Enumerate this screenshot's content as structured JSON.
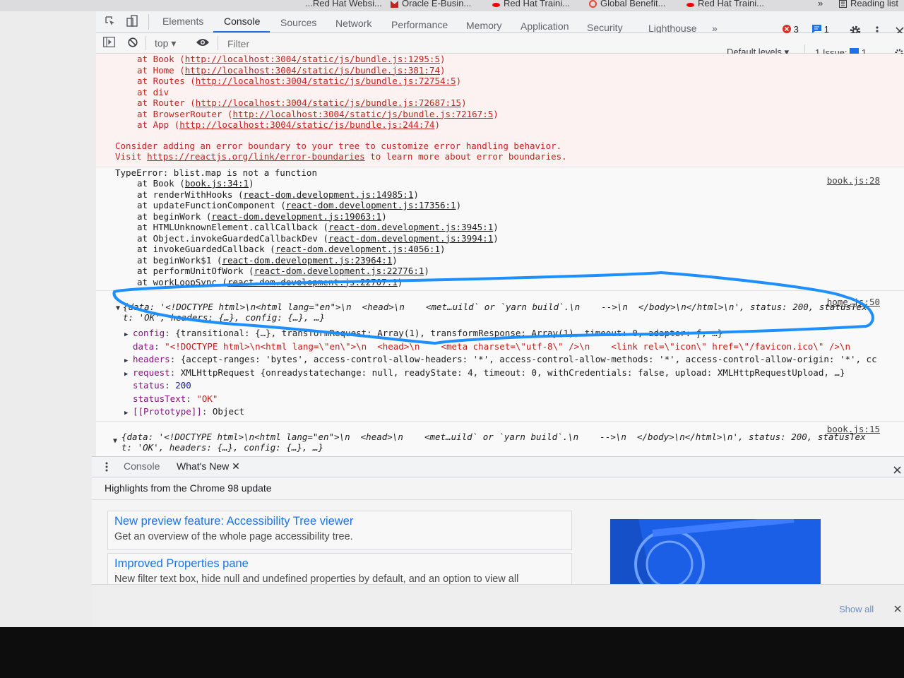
{
  "bookmarks": [
    "...Red Hat Websi...",
    "Oracle E-Busin...",
    "Red Hat Traini...",
    "Global Benefit...",
    "Red Hat Traini...",
    "»",
    "Reading list"
  ],
  "devtools": {
    "tabs": [
      "Elements",
      "Console",
      "Sources",
      "Network",
      "Performance",
      "Memory",
      "Application",
      "Security",
      "Lighthouse",
      "»"
    ],
    "active_tab": "Console",
    "error_count": "3",
    "message_count": "1",
    "toolbar": {
      "context": "top",
      "filter_placeholder": "Filter",
      "levels": "Default levels",
      "issues_label": "1 Issue:",
      "issues_count": "1"
    }
  },
  "console": {
    "stack1": [
      {
        "fn": "at Book",
        "link": "http://localhost:3004/static/js/bundle.js:1295:5"
      },
      {
        "fn": "at Home",
        "link": "http://localhost:3004/static/js/bundle.js:381:74"
      },
      {
        "fn": "at Routes",
        "link": "http://localhost:3004/static/js/bundle.js:72754:5"
      },
      {
        "fn": "at div",
        "link": ""
      },
      {
        "fn": "at Router",
        "link": "http://localhost:3004/static/js/bundle.js:72687:15"
      },
      {
        "fn": "at BrowserRouter",
        "link": "http://localhost:3004/static/js/bundle.js:72167:5"
      },
      {
        "fn": "at App",
        "link": "http://localhost:3004/static/js/bundle.js:244:74"
      }
    ],
    "boundary_line1": "Consider adding an error boundary to your tree to customize error handling behavior.",
    "boundary_line2_prefix": "Visit ",
    "boundary_link": "https://reactjs.org/link/error-boundaries",
    "boundary_line2_suffix": " to learn more about error boundaries.",
    "type_error": "TypeError: blist.map is not a function",
    "type_error_source": "book.js:28",
    "stack2": [
      {
        "fn": "at Book",
        "link": "book.js:34:1"
      },
      {
        "fn": "at renderWithHooks",
        "link": "react-dom.development.js:14985:1"
      },
      {
        "fn": "at updateFunctionComponent",
        "link": "react-dom.development.js:17356:1"
      },
      {
        "fn": "at beginWork",
        "link": "react-dom.development.js:19063:1"
      },
      {
        "fn": "at HTMLUnknownElement.callCallback",
        "link": "react-dom.development.js:3945:1"
      },
      {
        "fn": "at Object.invokeGuardedCallbackDev",
        "link": "react-dom.development.js:3994:1"
      },
      {
        "fn": "at invokeGuardedCallback",
        "link": "react-dom.development.js:4056:1"
      },
      {
        "fn": "at beginWork$1",
        "link": "react-dom.development.js:23964:1"
      },
      {
        "fn": "at performUnitOfWork",
        "link": "react-dom.development.js:22776:1"
      },
      {
        "fn": "at workLoopSync",
        "link": "react-dom.development.js:22707:1"
      }
    ],
    "obj1_source": "home.js:50",
    "obj1_line1": "{data: '<!DOCTYPE html>\\n<html lang=\"en\">\\n  <head>\\n    <met…uild` or `yarn build`.\\n    -->\\n  </body>\\n</html>\\n', status: 200, statusTex",
    "obj1_line2": "t: 'OK', headers: {…}, config: {…}, …}",
    "props": [
      {
        "arrow": "▶",
        "key": "config",
        "value": "{transitional: {…}, transformRequest: Array(1), transformResponse: Array(1), timeout: 0, adapter: ƒ, …}"
      },
      {
        "arrow": "",
        "key": "data",
        "value": "\"<!DOCTYPE html>\\n<html lang=\\\"en\\\">\\n  <head>\\n    <meta charset=\\\"utf-8\\\" />\\n    <link rel=\\\"icon\\\" href=\\\"/favicon.ico\\\" />\\n"
      },
      {
        "arrow": "▶",
        "key": "headers",
        "value": "{accept-ranges: 'bytes', access-control-allow-headers: '*', access-control-allow-methods: '*', access-control-allow-origin: '*', cc"
      },
      {
        "arrow": "▶",
        "key": "request",
        "value": "XMLHttpRequest {onreadystatechange: null, readyState: 4, timeout: 0, withCredentials: false, upload: XMLHttpRequestUpload, …}"
      },
      {
        "arrow": "",
        "key": "status",
        "value": "200"
      },
      {
        "arrow": "",
        "key": "statusText",
        "value": "\"OK\""
      },
      {
        "arrow": "▶",
        "key": "[[Prototype]]",
        "value": "Object"
      }
    ],
    "obj2_source": "book.js:15",
    "obj2_line1": "{data: '<!DOCTYPE html>\\n<html lang=\"en\">\\n  <head>\\n    <met…uild` or `yarn build`.\\n    -->\\n  </body>\\n</html>\\n', status: 200, statusTex",
    "obj2_line2": "t: 'OK', headers: {…}, config: {…}, …}"
  },
  "drawer": {
    "tabs": [
      "Console",
      "What's New"
    ],
    "headline": "Highlights from the Chrome 98 update",
    "cards": [
      {
        "title": "New preview feature: Accessibility Tree viewer",
        "desc": "Get an overview of the whole page accessibility tree."
      },
      {
        "title": "Improved Properties pane",
        "desc": "New filter text box, hide null and undefined properties by default, and an option to view all"
      }
    ],
    "show_all": "Show all"
  },
  "colors": {
    "accent": "#1a73e8",
    "error": "#c5221f",
    "annotation": "#1e8fff"
  }
}
